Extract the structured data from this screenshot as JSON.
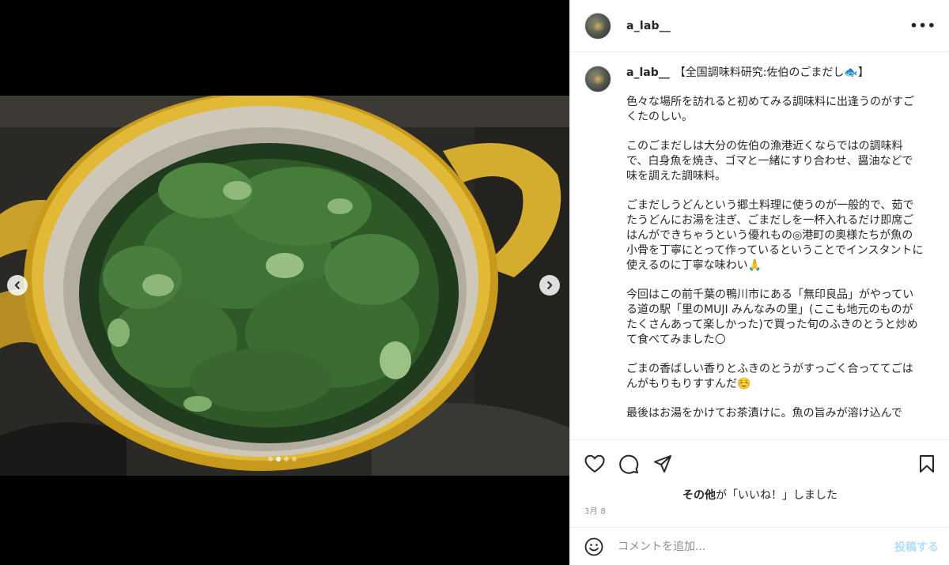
{
  "post": {
    "username": "a_lab__",
    "caption": {
      "title": "【全国調味料研究:佐伯のごまだし🐟】",
      "paragraphs": [
        "色々な場所を訪れると初めてみる調味料に出逢うのがすごくたのしい。",
        "このごまだしは大分の佐伯の漁港近くならではの調味料で、白身魚を焼き、ゴマと一緒にすり合わせ、醤油などで味を調えた調味料。",
        "ごまだしうどんという郷土料理に使うのが一般的で、茹でたうどんにお湯を注ぎ、ごまだしを一杯入れるだけ即席ごはんができちゃうという優れもの◎港町の奥様たちが魚の小骨を丁寧にとって作っているということでインスタントに使えるのに丁寧な味わい🙏",
        "今回はこの前千葉の鴨川市にある「無印良品」がやっている道の駅「里のMUJI みんなみの里」(ここも地元のものがたくさんあって楽しかった)で買った旬のふきのとうと炒めて食べてみました🌕",
        "ごまの香ばしい香りとふきのとうがすっごく合っててごはんがもりもりすすんだ☺️",
        "最後はお湯をかけてお茶漬けに。魚の旨みが溶け込んで"
      ]
    },
    "likes": {
      "bold": "その他",
      "rest": "が「いいね！」しました"
    },
    "date": "3月 8",
    "comment": {
      "placeholder": "コメントを追加...",
      "post_label": "投稿する"
    },
    "carousel": {
      "count": 4,
      "active_index": 1
    }
  },
  "icons": {
    "more": "more-options-icon",
    "like": "heart-icon",
    "comment": "comment-icon",
    "share": "share-icon",
    "save": "bookmark-icon",
    "emoji": "emoji-icon",
    "prev": "chevron-left-icon",
    "next": "chevron-right-icon"
  },
  "colors": {
    "text": "#262626",
    "muted": "#8e8e8e",
    "post_button": "#b2dffc",
    "border": "#efefef"
  }
}
